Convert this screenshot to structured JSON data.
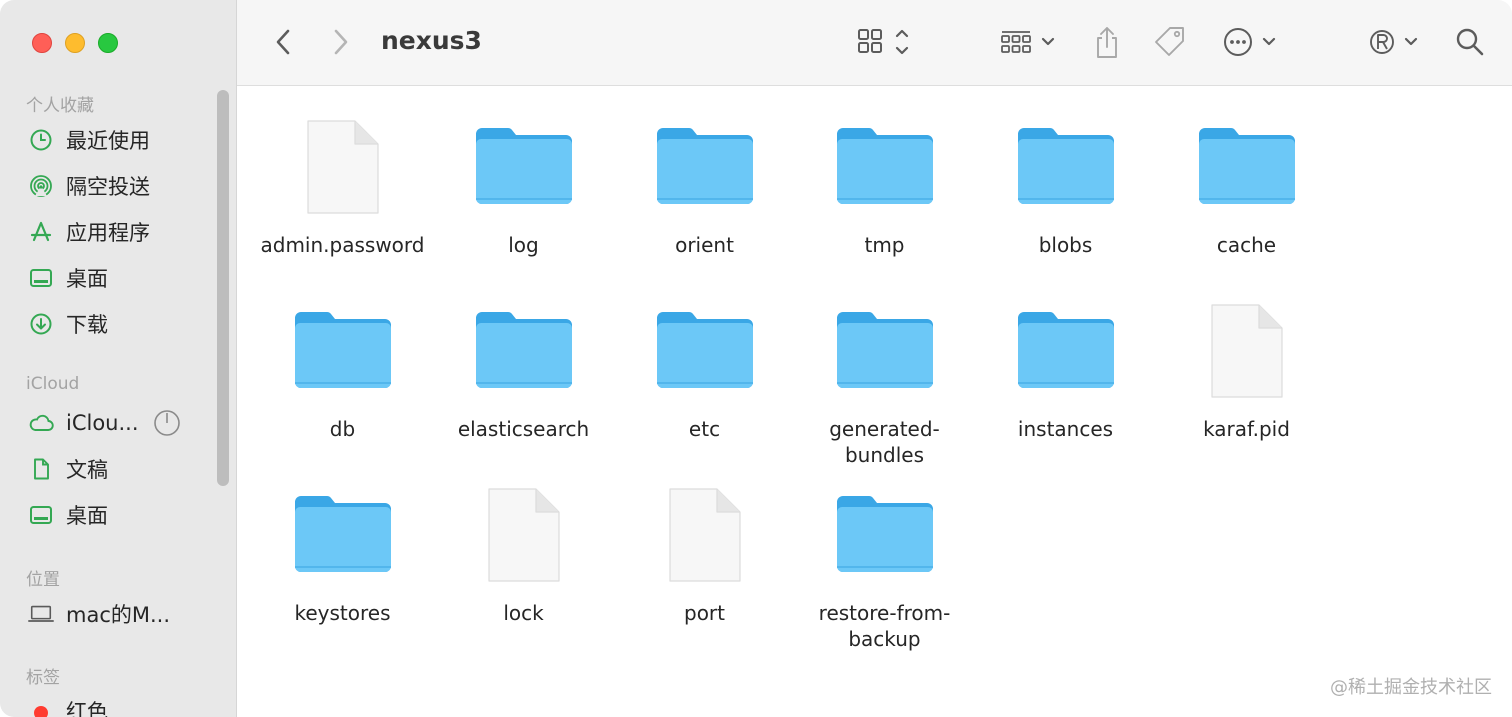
{
  "window": {
    "title": "nexus3"
  },
  "sidebar": {
    "sections": {
      "favorites": "个人收藏",
      "icloud": "iCloud",
      "locations": "位置",
      "tags": "标签"
    },
    "favorites": [
      {
        "label": "最近使用",
        "icon": "clock-icon"
      },
      {
        "label": "隔空投送",
        "icon": "airdrop-icon"
      },
      {
        "label": "应用程序",
        "icon": "applications-icon"
      },
      {
        "label": "桌面",
        "icon": "desktop-icon"
      },
      {
        "label": "下载",
        "icon": "download-icon"
      }
    ],
    "icloud": [
      {
        "label": "iClou...",
        "icon": "cloud-icon"
      },
      {
        "label": "文稿",
        "icon": "document-icon"
      },
      {
        "label": "桌面",
        "icon": "desktop-icon"
      }
    ],
    "locations": [
      {
        "label": "mac的M...",
        "icon": "laptop-icon"
      }
    ],
    "tags": [
      {
        "label": "红色",
        "color": "#ff3b30"
      }
    ]
  },
  "files": [
    {
      "name": "admin.password",
      "type": "file"
    },
    {
      "name": "log",
      "type": "folder"
    },
    {
      "name": "orient",
      "type": "folder"
    },
    {
      "name": "tmp",
      "type": "folder"
    },
    {
      "name": "blobs",
      "type": "folder"
    },
    {
      "name": "cache",
      "type": "folder"
    },
    {
      "name": "db",
      "type": "folder"
    },
    {
      "name": "elasticsearch",
      "type": "folder"
    },
    {
      "name": "etc",
      "type": "folder"
    },
    {
      "name": "generated-bundles",
      "type": "folder"
    },
    {
      "name": "instances",
      "type": "folder"
    },
    {
      "name": "karaf.pid",
      "type": "file"
    },
    {
      "name": "keystores",
      "type": "folder"
    },
    {
      "name": "lock",
      "type": "file"
    },
    {
      "name": "port",
      "type": "file"
    },
    {
      "name": "restore-from-backup",
      "type": "folder"
    }
  ],
  "colors": {
    "accent": "#34a853",
    "folder": "#6cc8f7",
    "folder_tab": "#3aa7e6"
  },
  "watermark": "@稀土掘金技术社区"
}
